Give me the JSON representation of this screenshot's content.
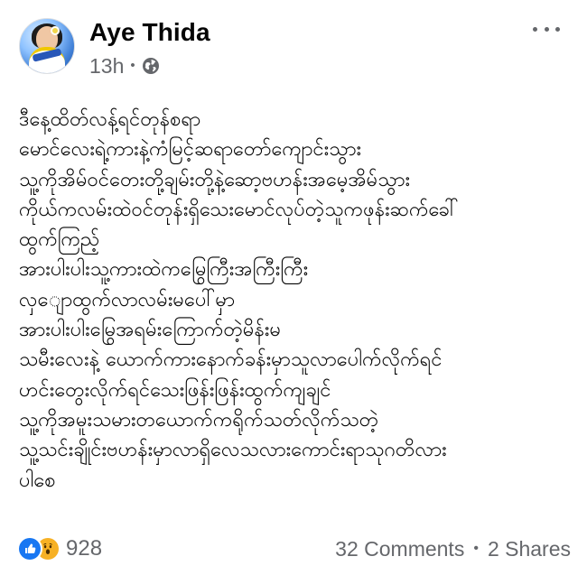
{
  "post": {
    "author": "Aye Thida",
    "meta": {
      "time": "13h",
      "separator": "•",
      "privacy_icon": "globe-icon"
    },
    "text": "ဒီနေ့ထိတ်လန့်ရင်တုန်စရာ\nမောင်လေးရဲ့ကားနဲ့ကံမြင့်ဆရာတော်ကျောင်းသွား\nသူ့ကိုအိမ်ဝင်တေးတို့ချမ်းတို့နဲ့ဆော့ဗဟန်းအမေ့အိမ်သွား\nကိုယ်ကလမ်းထဲဝင်တုန်းရှိသေးမောင်လုပ်တဲ့သူကဖုန်းဆက်ခေါ်\nထွက်ကြည့်\nအားပါးပါးသူ့ကားထဲကမြွေကြီးအကြီးကြီး\nလှျောထွက်လာလမ်းမပေါ်မှာ\nအားပါးပါးမြွေအရမ်းကြောက်တဲ့မိန်းမ\nသမီးလေးနဲ့ ယောက်ကားနောက်ခန်းမှာသူလာပေါက်လိုက်ရင်\nဟင်းတွေးလိုက်ရင်သေးဖြန်းဖြန်းထွက်ကျချင်\nသူ့ကိုအမူးသမားတယောက်ကရိုက်သတ်လိုက်သတဲ့\nသူ့သင်းချိုင်းဗဟန်းမှာလာရှိလေသလားကောင်းရာသုဂတိလား\nပါစေ",
    "reactions": {
      "types": [
        "like-icon",
        "wow-icon"
      ],
      "count": "928"
    },
    "stats": {
      "comments": "32 Comments",
      "separator": "•",
      "shares": "2 Shares"
    }
  },
  "colors": {
    "primary_text": "#050505",
    "secondary_text": "#65676b",
    "like_blue": "#1877f2",
    "wow_yellow": "#f7b125",
    "background": "#ffffff"
  }
}
